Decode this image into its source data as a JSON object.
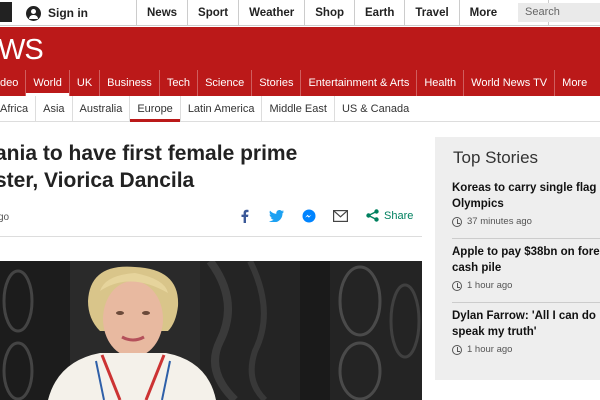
{
  "topbar": {
    "signin_label": "Sign in",
    "nav": [
      "News",
      "Sport",
      "Weather",
      "Shop",
      "Earth",
      "Travel"
    ],
    "more_label": "More",
    "search_placeholder": "Search"
  },
  "header": {
    "wordmark": "WS",
    "brand_color": "#bb1919"
  },
  "main_nav": {
    "items": [
      "deo",
      "World",
      "UK",
      "Business",
      "Tech",
      "Science",
      "Stories",
      "Entertainment & Arts",
      "Health",
      "World News TV",
      "More"
    ],
    "active": "World"
  },
  "sub_nav": {
    "items": [
      "Africa",
      "Asia",
      "Australia",
      "Europe",
      "Latin America",
      "Middle East",
      "US & Canada"
    ],
    "active": "Europe"
  },
  "article": {
    "headline_line1": "ania to have first female prime",
    "headline_line2": "ster, Viorica Dancila",
    "timestamp": "go",
    "share_label": "Share",
    "share_color": "#00805f"
  },
  "sidebar": {
    "title": "Top Stories",
    "stories": [
      {
        "line1": "Koreas to carry single flag",
        "line2": "Olympics",
        "time": "37 minutes ago"
      },
      {
        "line1": "Apple to pay $38bn on fore",
        "line2": "cash pile",
        "time": "1 hour ago"
      },
      {
        "line1": "Dylan Farrow: 'All I can do",
        "line2": "speak my truth'",
        "time": "1 hour ago"
      }
    ]
  }
}
